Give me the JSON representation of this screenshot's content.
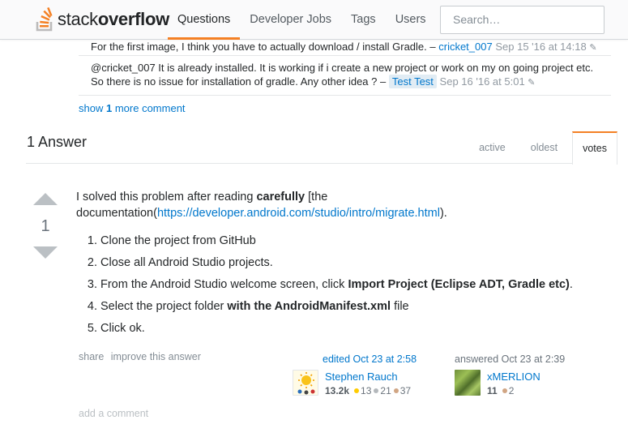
{
  "header": {
    "logo_prefix": "stack",
    "logo_suffix": "overflow",
    "nav": [
      "Questions",
      "Developer Jobs",
      "Tags",
      "Users"
    ],
    "search_placeholder": "Search…"
  },
  "comments": [
    {
      "text": "For the first image, I think you have to actually download / install Gradle. –",
      "user": "cricket_007",
      "date": "Sep 15 '16 at 14:18"
    },
    {
      "text": "@cricket_007 It is already installed. It is working if i create a new project or work on my on going project etc. So there is no issue for installation of gradle. Any other idea ? –",
      "user": "Test Test",
      "date": "Sep 16 '16 at 5:01"
    }
  ],
  "show_more": {
    "prefix": "show",
    "count": "1",
    "suffix": "more comment"
  },
  "answers": {
    "heading": "1 Answer",
    "tabs": [
      "active",
      "oldest",
      "votes"
    ],
    "active_tab": "votes"
  },
  "answer": {
    "votes": "1",
    "intro_before": "I solved this problem after reading ",
    "intro_bold": "carefully",
    "intro_mid": " [the documentation(",
    "link": "https://developer.android.com/studio/intro/migrate.html",
    "intro_after": ").",
    "steps": {
      "s1": "Clone the project from GitHub",
      "s2": "Close all Android Studio projects.",
      "s3_before": "From the Android Studio welcome screen, click ",
      "s3_bold": "Import Project (Eclipse ADT, Gradle etc)",
      "s3_after": ".",
      "s4_before": "Select the project folder ",
      "s4_bold": "with the AndroidManifest.xml",
      "s4_after": " file",
      "s5": "Click ok."
    },
    "menu": [
      "share",
      "improve this answer"
    ],
    "editor": {
      "action": "edited Oct 23 at 2:58",
      "name": "Stephen Rauch",
      "rep": "13.2k",
      "gold": "13",
      "silver": "21",
      "bronze": "37"
    },
    "author": {
      "action": "answered Oct 23 at 2:39",
      "name": "xMERLION",
      "rep": "11",
      "bronze": "2"
    },
    "add_comment": "add a comment"
  },
  "colors": {
    "accent": "#f48024",
    "link": "#0077cc",
    "vote_arrow": "#bbc0c4"
  }
}
